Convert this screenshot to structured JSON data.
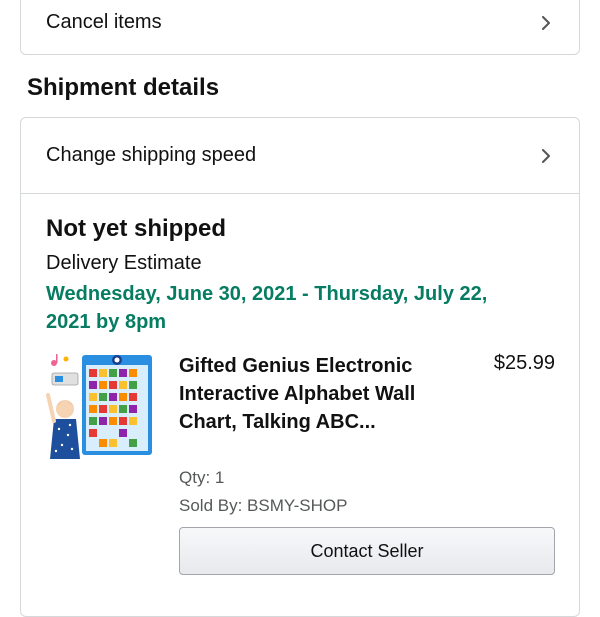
{
  "top_card": {
    "cancel_label": "Cancel items"
  },
  "shipment": {
    "section_title": "Shipment details",
    "change_speed_label": "Change shipping speed",
    "status": "Not yet shipped",
    "estimate_label": "Delivery Estimate",
    "estimate_date": "Wednesday, June 30, 2021 - Thursday, July 22, 2021 by 8pm"
  },
  "item": {
    "title": "Gifted Genius Electronic Interactive Alphabet Wall Chart, Talking ABC...",
    "price": "$25.99",
    "qty": "Qty: 1",
    "sold_by": "Sold By: BSMY-SHOP",
    "contact_label": "Contact Seller"
  },
  "colors": {
    "accent_green": "#067d62",
    "border": "#d5d9d9",
    "secondary_text": "#565959"
  },
  "icons": {
    "chevron": "chevron-right-icon"
  }
}
